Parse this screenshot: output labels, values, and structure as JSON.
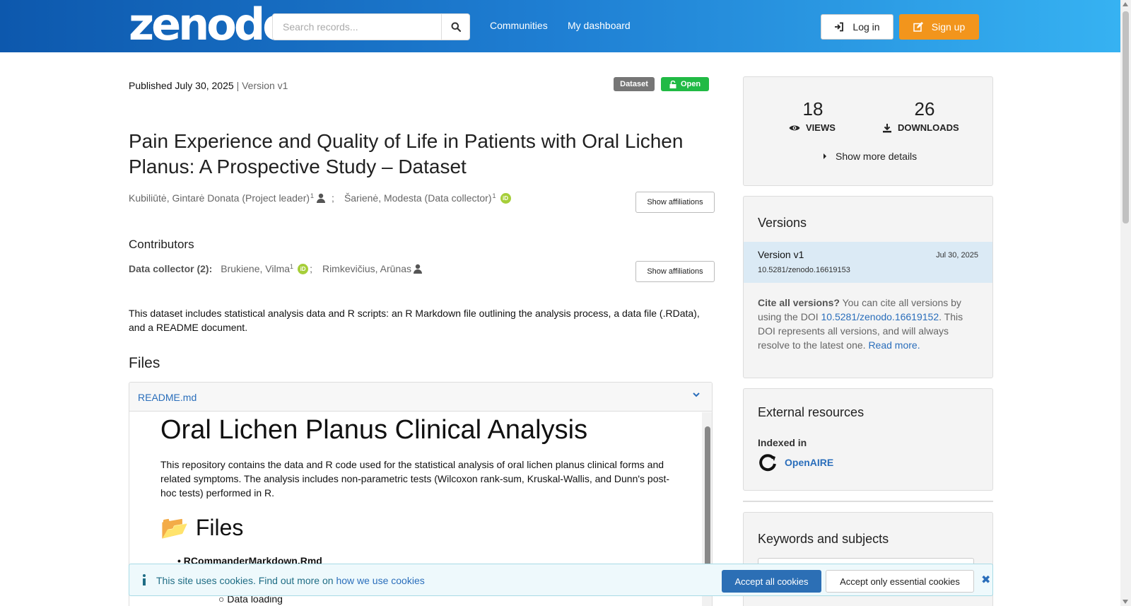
{
  "header": {
    "logo": "zenodo",
    "search_placeholder": "Search records...",
    "nav": [
      "Communities",
      "My dashboard"
    ],
    "login_label": "Log in",
    "signup_label": "Sign up"
  },
  "record": {
    "published": "Published July 30, 2025",
    "version": "| Version v1",
    "badges": {
      "type": "Dataset",
      "access": "Open"
    },
    "title": "Pain Experience and Quality of Life in Patients with Oral Lichen Planus: A Prospective Study – Dataset",
    "creators": [
      {
        "name": "Kubiliūtė, Gintarė Donata (Project leader)",
        "aff": "1",
        "icon": "person-icon"
      },
      {
        "name": "Šarienė, Modesta (Data collector)",
        "aff": "1",
        "icon": "orcid-icon"
      }
    ],
    "separator": ";",
    "show_affiliations": "Show affiliations",
    "contributors_heading": "Contributors",
    "contributor_role": "Data collector (2):",
    "contributors": [
      {
        "name": "Brukiene, Vilma",
        "aff": "1",
        "icon": "orcid-icon"
      },
      {
        "name": "Rimkevičius, Arūnas",
        "icon": "person-icon"
      }
    ],
    "description": "This dataset includes statistical analysis data and R scripts: an R Markdown file outlining the analysis process, a data file (.RData), and a README document."
  },
  "files": {
    "heading": "Files",
    "file_name": "README.md",
    "preview": {
      "h1": "Oral Lichen Planus Clinical Analysis",
      "p": "This repository contains the data and R code used for the statistical analysis of oral lichen planus clinical forms and related symptoms. The analysis includes non-parametric tests (Wilcoxon rank-sum, Kruskal-Wallis, and Dunn's post-hoc tests) performed in R.",
      "h2_icon": "📂",
      "h2": "Files",
      "item1": "RCommanderMarkdown.Rmd",
      "item2": "Data loading"
    }
  },
  "sidebar": {
    "views_count": "18",
    "views_label": "VIEWS",
    "downloads_count": "26",
    "downloads_label": "DOWNLOADS",
    "more_details": "Show more details",
    "versions_title": "Versions",
    "version_name": "Version v1",
    "version_date": "Jul 30, 2025",
    "version_doi": "10.5281/zenodo.16619153",
    "cite_bold": "Cite all versions?",
    "cite_text1": " You can cite all versions by using the DOI ",
    "cite_doi": "10.5281/zenodo.16619152",
    "cite_text2": ". This DOI represents all versions, and will always resolve to the latest one. ",
    "read_more": "Read more.",
    "external_title": "External resources",
    "indexed_in": "Indexed in",
    "openaire": "OpenAIRE",
    "keywords_title": "Keywords and subjects"
  },
  "cookie": {
    "text": "This site uses cookies. Find out more on ",
    "link": "how we use cookies",
    "accept_all": "Accept all cookies",
    "accept_essential": "Accept only essential cookies"
  },
  "colors": {
    "header_start": "#0d58ad",
    "header_end": "#36b2f2",
    "signup": "#f2951c",
    "open_badge": "#21ba45",
    "link": "#2a6ebb",
    "accept_all": "#2c6fb5"
  }
}
